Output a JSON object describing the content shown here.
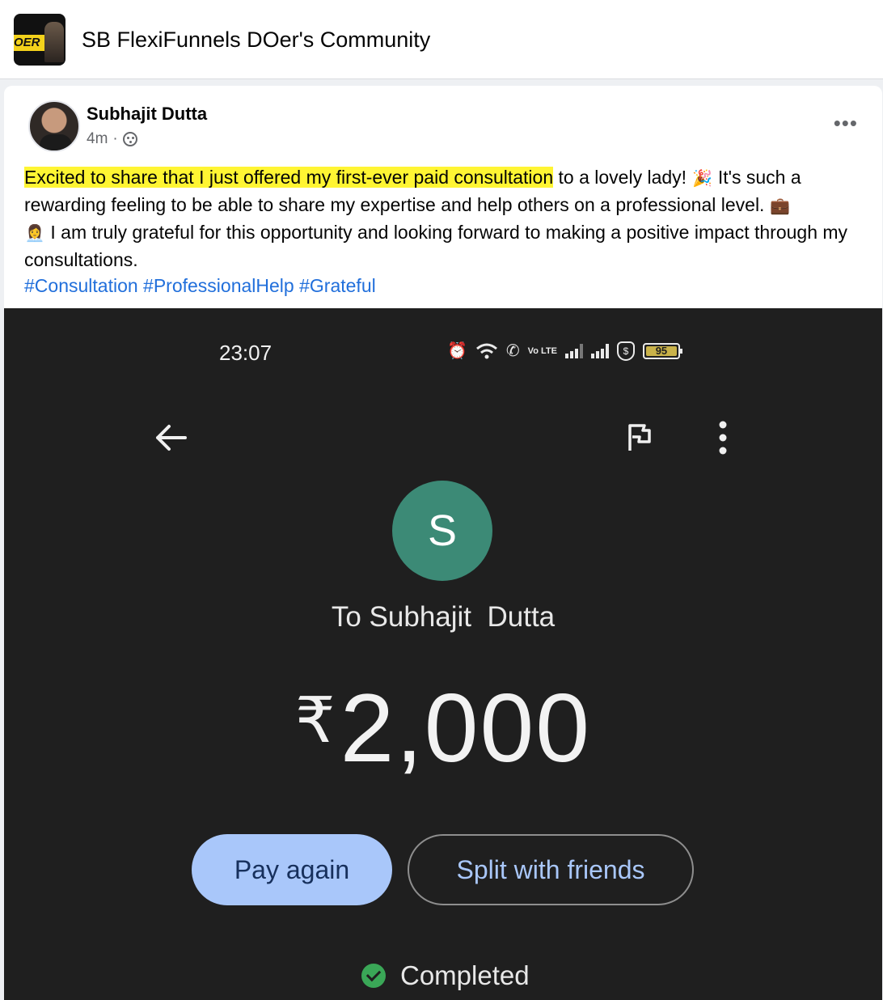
{
  "group": {
    "title": "SB FlexiFunnels DOer's Community",
    "logo_text": "OER"
  },
  "post": {
    "author": "Subhajit Dutta",
    "time": "4m",
    "separator": "·",
    "more_label": "•••",
    "text_highlighted": "Excited to share that I just offered my first-ever paid consultation",
    "text_part1": " to a lovely lady! ",
    "emoji1": "🎉",
    "text_part2": " It's such a rewarding feeling to be able to share my expertise and help others on a professional level. ",
    "emoji2": "💼",
    "emoji3": "👩‍💼",
    "text_part3": " I am truly grateful for this opportunity and looking forward to making a positive impact through my consultations.",
    "hashtags": [
      "#Consultation",
      "#ProfessionalHelp",
      "#Grateful"
    ]
  },
  "screenshot": {
    "status_time": "23:07",
    "battery_level": "95",
    "network_label": "Vo LTE",
    "shield_label": "$",
    "recipient_initial": "S",
    "recipient_label": "To Subhajit  Dutta",
    "currency_symbol": "₹",
    "amount": "2,000",
    "pay_again_label": "Pay again",
    "split_label": "Split with friends",
    "status_label": "Completed",
    "colors": {
      "background": "#1f1f1f",
      "avatar": "#3c8a76",
      "primary_button": "#a9c7fa",
      "success": "#3aa757"
    }
  }
}
